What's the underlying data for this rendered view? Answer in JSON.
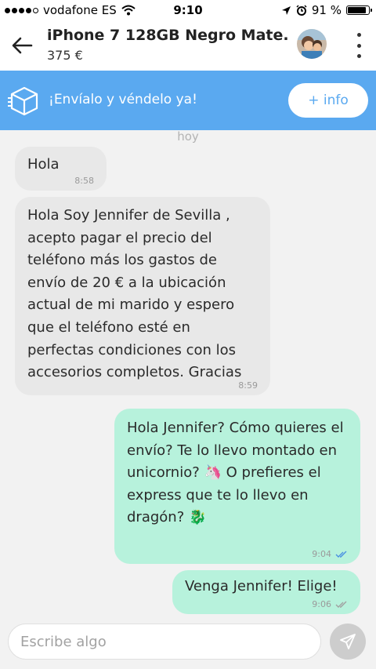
{
  "status_bar": {
    "carrier": "vodafone ES",
    "time": "9:10",
    "battery": "91 %",
    "battery_level": 0.91,
    "signal_dots": "●●●●○"
  },
  "header": {
    "title": "iPhone 7 128GB Negro Mate.",
    "price": "375 €",
    "back_icon": "arrow-left-icon",
    "menu_icon": "kebab-menu-icon"
  },
  "banner": {
    "text": "¡Envíalo y véndelo ya!",
    "button": "+ info",
    "icon": "shipping-box-icon",
    "color": "#5aa9f0"
  },
  "chat": {
    "day_label": "hoy",
    "messages": [
      {
        "direction": "in",
        "text": "Hola",
        "time": "8:58"
      },
      {
        "direction": "in",
        "text": "Hola Soy Jennifer de Sevilla , acepto pagar el precio del teléfono más los gastos de envío de 20 € a la ubicación actual de mi marido y espero que el teléfono esté en perfectas condiciones con los accesorios completos. Gracias",
        "time": "8:59"
      },
      {
        "direction": "out",
        "text": "Hola Jennifer? Cómo quieres el envío? Te lo llevo montado en unicornio? 🦄 O prefieres el express que te lo llevo en dragón? 🐉",
        "time": "9:04",
        "read": true
      },
      {
        "direction": "out",
        "text": "Venga Jennifer! Elige!",
        "time": "9:06",
        "read": false
      }
    ]
  },
  "composer": {
    "placeholder": "Escribe algo",
    "send_icon": "send-icon"
  },
  "colors": {
    "incoming_bubble": "#e8e8e8",
    "outgoing_bubble": "#b7f2dc",
    "read_check": "#4a90e2",
    "unread_check": "#a0a0a0"
  }
}
